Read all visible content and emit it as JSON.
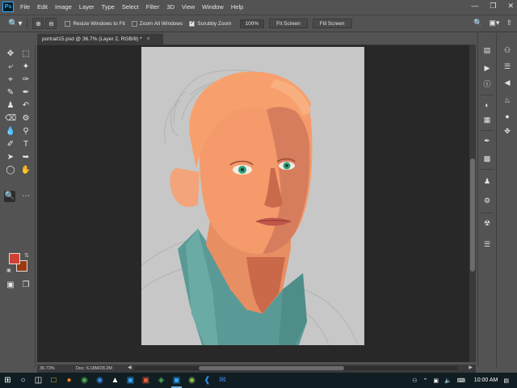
{
  "app": {
    "logo_text": "Ps"
  },
  "menu": [
    "File",
    "Edit",
    "Image",
    "Layer",
    "Type",
    "Select",
    "Filter",
    "3D",
    "View",
    "Window",
    "Help"
  ],
  "window_controls": {
    "minimize": "—",
    "restore": "❐",
    "close": "✕"
  },
  "options_bar": {
    "resize_windows_label": "Resize Windows to Fit",
    "resize_windows_checked": false,
    "zoom_all_label": "Zoom All Windows",
    "zoom_all_checked": false,
    "scrubby_zoom_label": "Scrubby Zoom",
    "scrubby_zoom_checked": true,
    "zoom_value": "100%",
    "fit_screen_label": "Fit Screen",
    "fill_screen_label": "Fill Screen"
  },
  "document": {
    "tab_title": "portrait15.psd @ 36.7% (Layer 2, RGB/8) *",
    "close_glyph": "×"
  },
  "colors": {
    "foreground": "#d04134",
    "background": "#9b3a10",
    "canvas_bg": "#282828",
    "artboard_bg": "#c7c7c7",
    "skin": "#f59a6a",
    "shirt": "#5a9a96"
  },
  "status": {
    "zoom": "36.73%",
    "doc_info": "Doc: 6.18M/28.2M"
  },
  "taskbar": {
    "time": "10:00 AM",
    "apps": [
      "start-icon",
      "search-icon",
      "task-view-icon",
      "file-explorer-icon",
      "firefox-icon",
      "chrome-icon",
      "edge-icon",
      "inkscape-icon",
      "photoshop-icon",
      "photoshop-icon",
      "store-icon",
      "photoshop-icon",
      "paint-icon",
      "vscode-icon",
      "mail-icon"
    ]
  }
}
